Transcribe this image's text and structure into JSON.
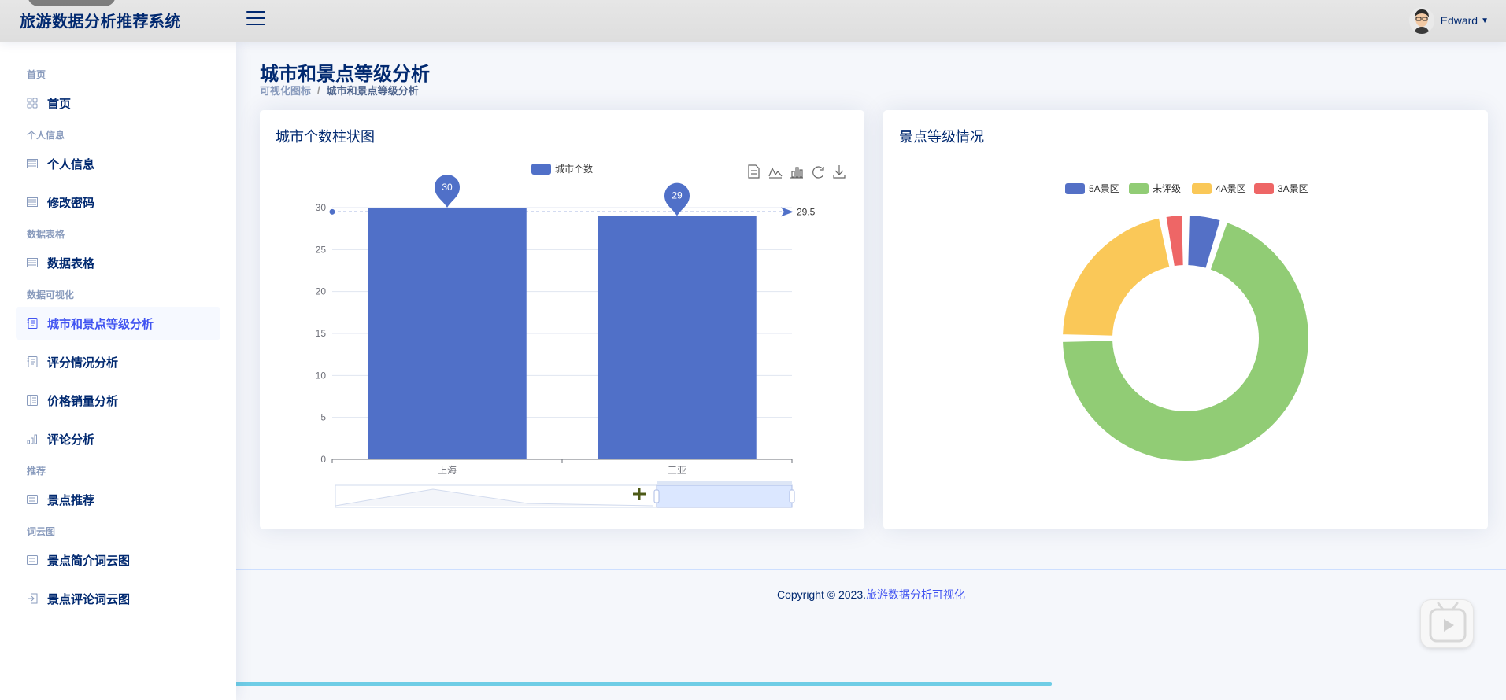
{
  "header": {
    "app_title": "旅游数据分析推荐系统",
    "user_name": "Edward"
  },
  "sidebar": {
    "sections": [
      {
        "heading": "首页",
        "items": [
          {
            "label": "首页",
            "icon": "grid-icon"
          }
        ]
      },
      {
        "heading": "个人信息",
        "items": [
          {
            "label": "个人信息",
            "icon": "card-list-icon"
          },
          {
            "label": "修改密码",
            "icon": "card-list-icon"
          }
        ]
      },
      {
        "heading": "数据表格",
        "items": [
          {
            "label": "数据表格",
            "icon": "card-list-icon"
          }
        ]
      },
      {
        "heading": "数据可视化",
        "items": [
          {
            "label": "城市和景点等级分析",
            "icon": "journal-text-icon",
            "active": true
          },
          {
            "label": "评分情况分析",
            "icon": "journal-text-icon"
          },
          {
            "label": "价格销量分析",
            "icon": "layout-text-icon"
          },
          {
            "label": "评论分析",
            "icon": "bar-chart-icon"
          }
        ]
      },
      {
        "heading": "推荐",
        "items": [
          {
            "label": "景点推荐",
            "icon": "list-icon"
          }
        ]
      },
      {
        "heading": "词云图",
        "items": [
          {
            "label": "景点简介词云图",
            "icon": "list-icon"
          },
          {
            "label": "景点评论词云图",
            "icon": "box-arrow-in-icon"
          }
        ]
      }
    ]
  },
  "page": {
    "title": "城市和景点等级分析",
    "breadcrumb": [
      "可视化图标",
      "城市和景点等级分析"
    ]
  },
  "cards": {
    "left_title": "城市个数柱状图",
    "right_title": "景点等级情况"
  },
  "chart_data": [
    {
      "type": "bar",
      "legend": [
        "城市个数"
      ],
      "categories": [
        "上海",
        "三亚"
      ],
      "series": [
        {
          "name": "城市个数",
          "values": [
            30,
            29
          ]
        }
      ],
      "ylim": [
        0,
        30
      ],
      "yticks": [
        0,
        5,
        10,
        15,
        20,
        25,
        30
      ],
      "markpoints": [
        30,
        29
      ],
      "markline_average": 29.5,
      "toolbox": [
        "data-view-icon",
        "line-icon",
        "bar-icon",
        "restore-icon",
        "download-icon"
      ],
      "color": "#5070c8",
      "datazoom": true
    },
    {
      "type": "pie",
      "donut": true,
      "legend": [
        "5A景区",
        "未评级",
        "4A景区",
        "3A景区"
      ],
      "series": [
        {
          "values": [
            5,
            70,
            22,
            3
          ]
        }
      ],
      "colors": [
        "#5470c6",
        "#91cc75",
        "#fac858",
        "#ee6666"
      ]
    }
  ],
  "footer": {
    "prefix": "Copyright © 2023.",
    "brand": "旅游数据分析可视化"
  }
}
